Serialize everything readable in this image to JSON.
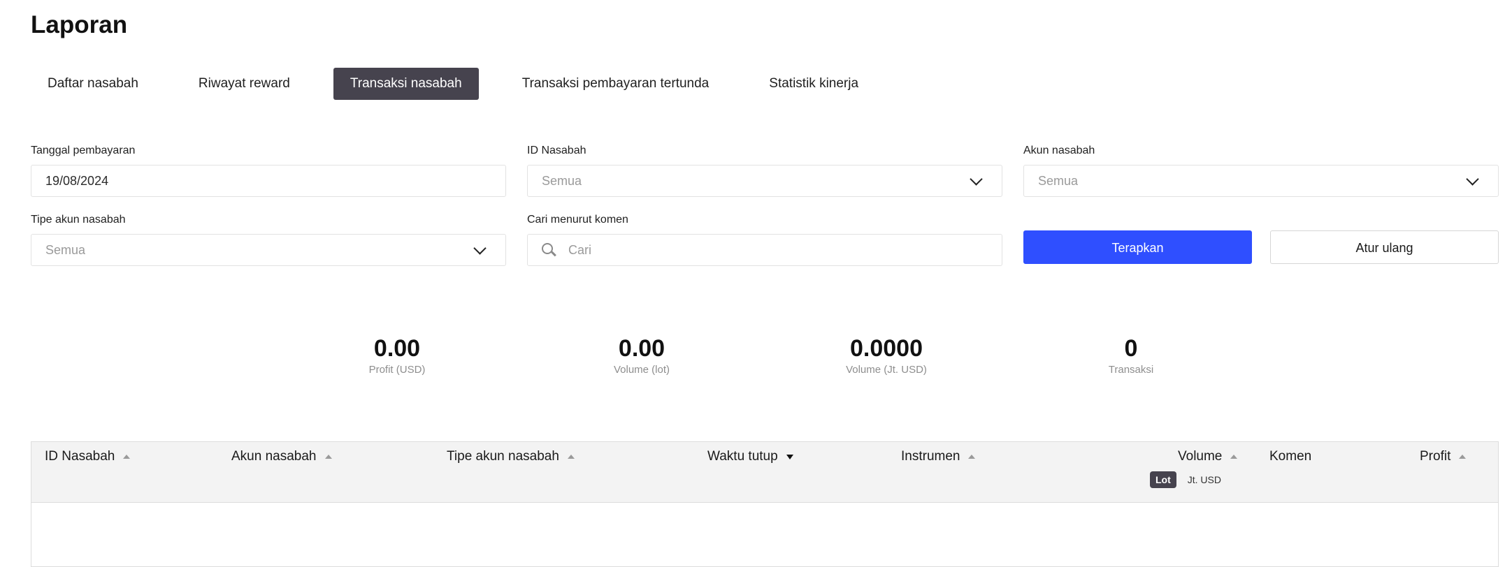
{
  "page": {
    "title": "Laporan"
  },
  "tabs": [
    {
      "label": "Daftar nasabah",
      "active": false
    },
    {
      "label": "Riwayat reward",
      "active": false
    },
    {
      "label": "Transaksi nasabah",
      "active": true
    },
    {
      "label": "Transaksi pembayaran tertunda",
      "active": false
    },
    {
      "label": "Statistik kinerja",
      "active": false
    }
  ],
  "filters": {
    "payment_date": {
      "label": "Tanggal pembayaran",
      "value": "19/08/2024"
    },
    "client_id": {
      "label": "ID Nasabah",
      "value": "Semua"
    },
    "client_account": {
      "label": "Akun nasabah",
      "value": "Semua"
    },
    "account_type": {
      "label": "Tipe akun nasabah",
      "value": "Semua"
    },
    "comment_search": {
      "label": "Cari menurut komen",
      "placeholder": "Cari"
    },
    "apply_label": "Terapkan",
    "reset_label": "Atur ulang"
  },
  "stats": [
    {
      "value": "0.00",
      "label": "Profit (USD)"
    },
    {
      "value": "0.00",
      "label": "Volume (lot)"
    },
    {
      "value": "0.0000",
      "label": "Volume (Jt. USD)"
    },
    {
      "value": "0",
      "label": "Transaksi"
    }
  ],
  "table": {
    "columns": [
      {
        "label": "ID Nasabah",
        "sort": "none"
      },
      {
        "label": "Akun nasabah",
        "sort": "none"
      },
      {
        "label": "Tipe akun nasabah",
        "sort": "none"
      },
      {
        "label": "Waktu tutup",
        "sort": "desc"
      },
      {
        "label": "Instrumen",
        "sort": "none"
      },
      {
        "label": "Volume",
        "sort": "none"
      },
      {
        "label": "Komen",
        "sort": null
      },
      {
        "label": "Profit",
        "sort": "none"
      }
    ],
    "volume_units": {
      "active": "Lot",
      "inactive": "Jt. USD"
    },
    "rows": []
  },
  "colors": {
    "accent": "#2f4fff",
    "active_tab": "#46434e",
    "header_bg": "#f3f3f3"
  }
}
